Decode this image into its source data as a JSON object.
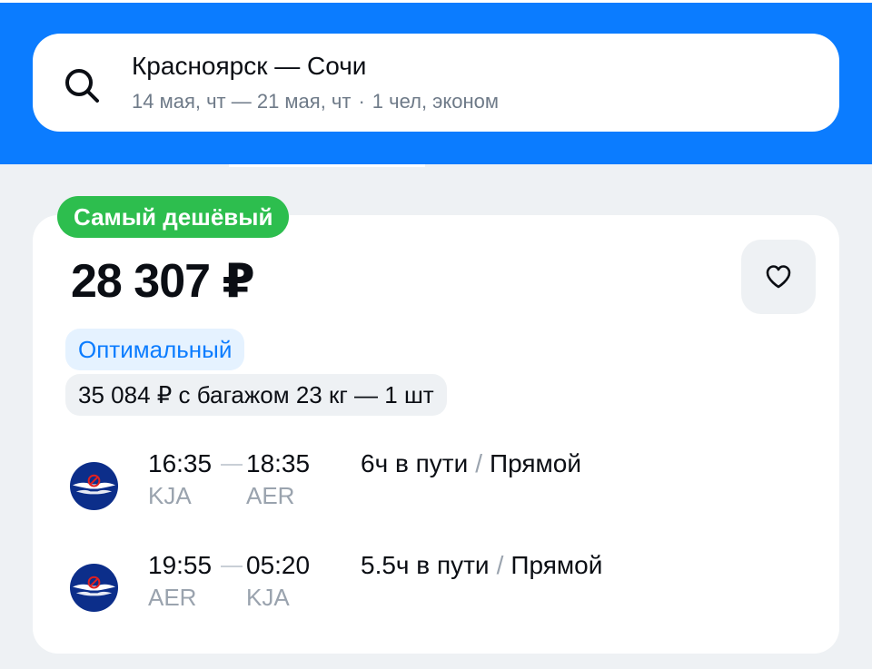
{
  "search": {
    "route": "Красноярск — Сочи",
    "dates": "14 мая, чт — 21 мая, чт",
    "separator": "·",
    "passengers": "1 чел, эконом"
  },
  "card": {
    "badge": "Самый дешёвый",
    "price": "28 307 ₽",
    "tag_optimal": "Оптимальный",
    "baggage_offer": "35 084 ₽ с багажом 23 кг — 1 шт"
  },
  "flights": [
    {
      "depart_time": "16:35",
      "arrive_time": "18:35",
      "from": "KJA",
      "to": "AER",
      "duration": "6ч в пути",
      "slash": "/",
      "type": "Прямой"
    },
    {
      "depart_time": "19:55",
      "arrive_time": "05:20",
      "from": "AER",
      "to": "KJA",
      "duration": "5.5ч в пути",
      "slash": "/",
      "type": "Прямой"
    }
  ],
  "colors": {
    "brand_blue": "#0B7CFF",
    "badge_green": "#2DBE4E",
    "background": "#EEF1F4",
    "airline_navy": "#0C2E8A"
  },
  "icons": {
    "search": "search-icon",
    "favorite": "heart-icon",
    "airline": "airline-logo-icon"
  }
}
